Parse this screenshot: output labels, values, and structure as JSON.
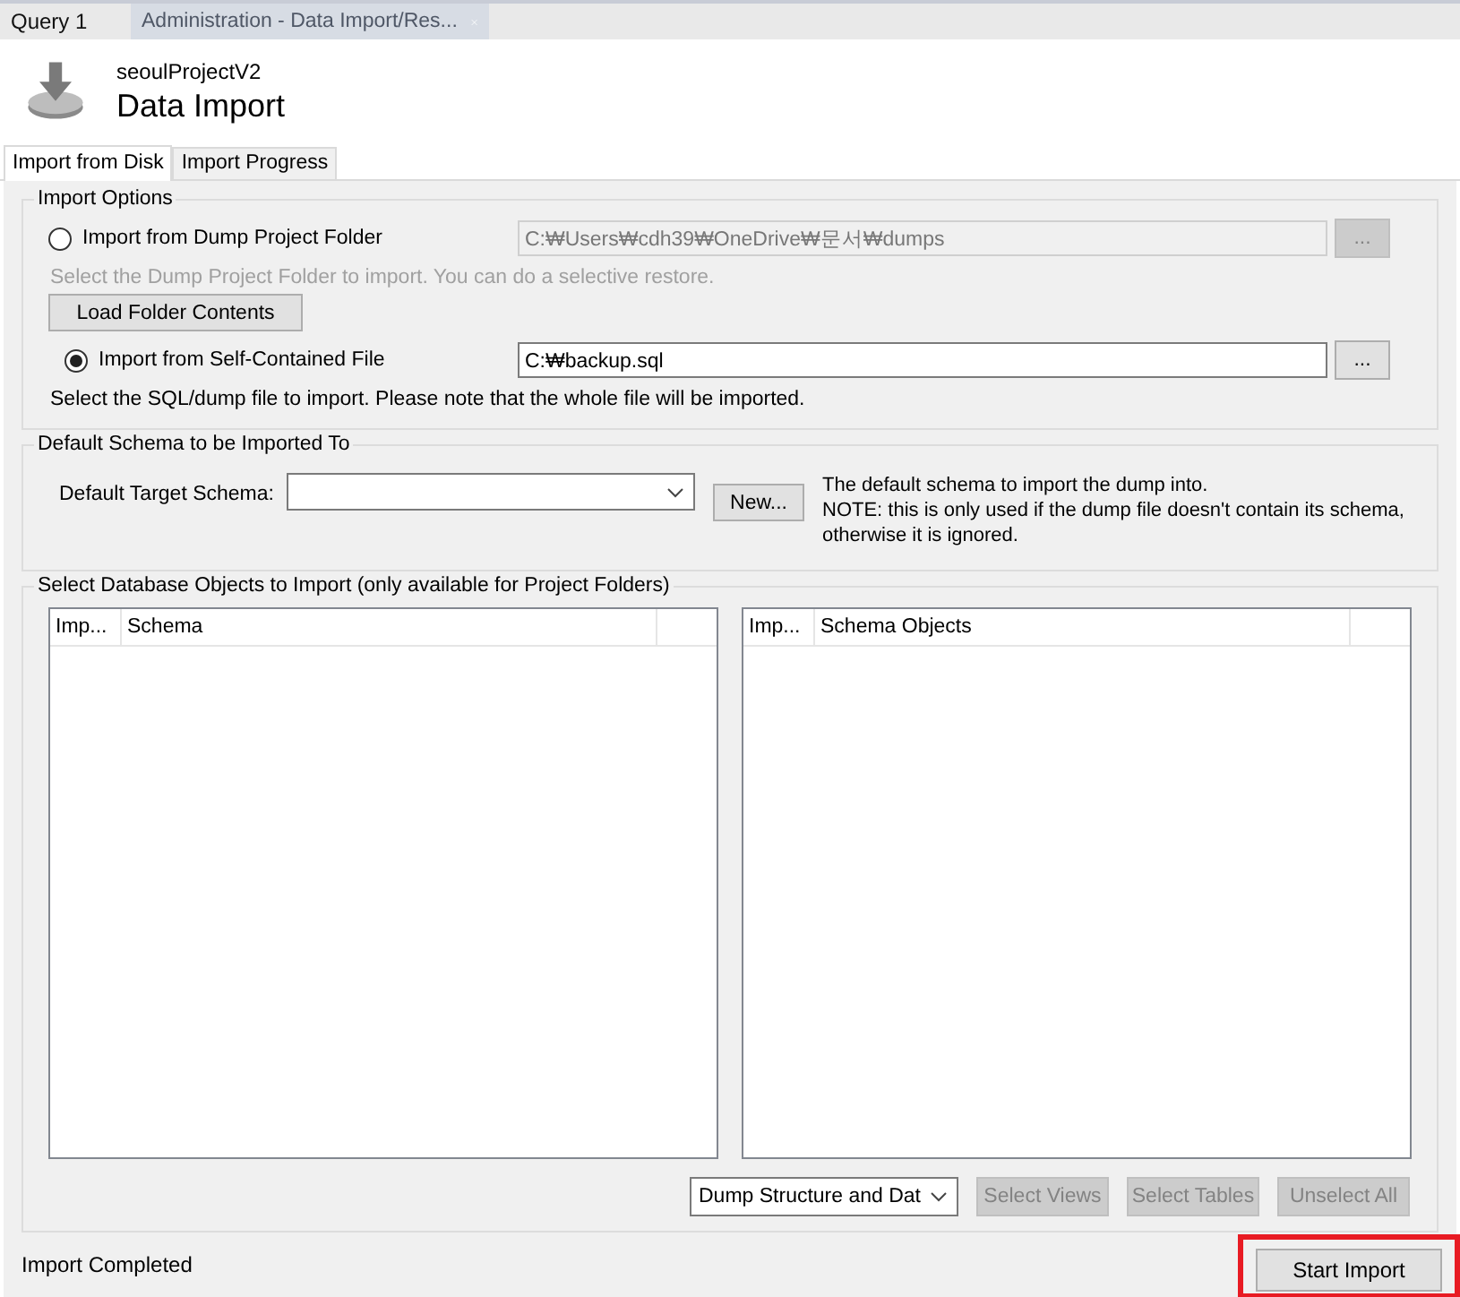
{
  "document_tabs": [
    {
      "label": "Query 1",
      "selected": false,
      "closable": false
    },
    {
      "label": "Administration - Data Import/Res...",
      "selected": true,
      "closable": true
    }
  ],
  "header": {
    "project": "seoulProjectV2",
    "title": "Data Import"
  },
  "tabs": [
    {
      "label": "Import from Disk",
      "selected": true
    },
    {
      "label": "Import Progress",
      "selected": false
    }
  ],
  "import_options": {
    "title": "Import Options",
    "options": [
      {
        "label": "Import from Dump Project Folder",
        "selected": false,
        "path": "C:₩Users₩cdh39₩OneDrive₩문서₩dumps",
        "path_disabled": true,
        "browse": "...",
        "hint": "Select the Dump Project Folder to import. You can do a selective restore.",
        "hint_disabled": true,
        "button": "Load Folder Contents"
      },
      {
        "label": "Import from Self-Contained File",
        "selected": true,
        "path": "C:₩backup.sql",
        "path_disabled": false,
        "browse": "...",
        "hint": "Select the SQL/dump file to import. Please note that the whole file will be imported.",
        "hint_disabled": false
      }
    ]
  },
  "default_schema": {
    "title": "Default Schema to be Imported To",
    "label": "Default Target Schema:",
    "new_button": "New...",
    "note_lines": [
      "The default schema to import the dump into.",
      "NOTE: this is only used if the dump file doesn't contain its schema,",
      "otherwise it is ignored."
    ]
  },
  "objects": {
    "title": "Select Database Objects to Import (only available for Project Folders)",
    "tables": [
      {
        "columns": [
          "Imp...",
          "Schema"
        ]
      },
      {
        "columns": [
          "Imp...",
          "Schema Objects"
        ]
      }
    ],
    "dump_mode": "Dump Structure and Dat",
    "buttons": [
      {
        "label": "Select Views",
        "disabled": true
      },
      {
        "label": "Select Tables",
        "disabled": true
      },
      {
        "label": "Unselect All",
        "disabled": true
      }
    ]
  },
  "status_bar": {
    "text": "Import Completed",
    "button": "Start Import",
    "highlighted": true
  }
}
